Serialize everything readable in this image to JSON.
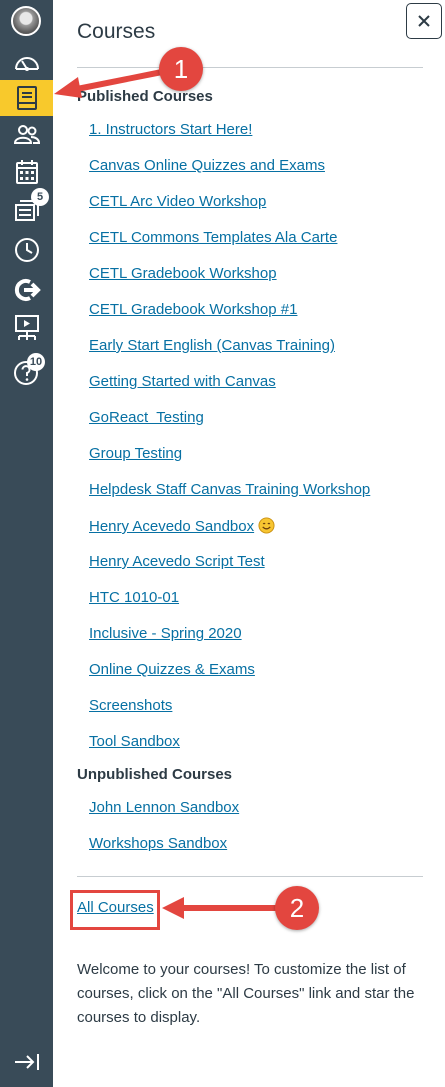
{
  "global_nav": {
    "items": [
      {
        "name": "account",
        "icon": "avatar"
      },
      {
        "name": "dashboard",
        "icon": "speedometer-icon"
      },
      {
        "name": "courses",
        "icon": "book-icon",
        "active": true
      },
      {
        "name": "groups",
        "icon": "users-icon"
      },
      {
        "name": "calendar",
        "icon": "calendar-icon"
      },
      {
        "name": "inbox",
        "icon": "inbox-icon",
        "badge": "5"
      },
      {
        "name": "history",
        "icon": "clock-icon"
      },
      {
        "name": "commons",
        "icon": "commons-icon"
      },
      {
        "name": "studio",
        "icon": "studio-icon"
      },
      {
        "name": "help",
        "icon": "help-icon",
        "badge": "10"
      }
    ],
    "collapse_icon": "collapse-icon"
  },
  "tray": {
    "title": "Courses",
    "published_heading": "Published Courses",
    "published_courses": [
      "1. Instructors Start Here!",
      "Canvas Online Quizzes and Exams",
      "CETL Arc Video Workshop",
      "CETL Commons Templates Ala Carte",
      "CETL Gradebook Workshop",
      "CETL Gradebook Workshop #1",
      "Early Start English (Canvas Training)",
      "Getting Started with Canvas",
      "GoReact  Testing",
      "Group Testing",
      "Helpdesk Staff Canvas Training Workshop",
      "Henry Acevedo Sandbox",
      "Henry Acevedo Script Test",
      "HTC 1010-01",
      "Inclusive - Spring 2020",
      "Online Quizzes & Exams",
      "Screenshots",
      "Tool Sandbox"
    ],
    "unpublished_heading": "Unpublished Courses",
    "unpublished_courses": [
      "John Lennon Sandbox",
      "Workshops Sandbox"
    ],
    "all_courses_label": "All Courses",
    "description": "Welcome to your courses! To customize the list of courses, click on the \"All Courses\" link and star the courses to display."
  },
  "annotations": {
    "callout_1": "1",
    "callout_2": "2",
    "color": "#E3463F"
  },
  "colors": {
    "nav_bg": "#394B58",
    "active": "#F8C92C",
    "link": "#0770A3",
    "text": "#2D3B45"
  }
}
